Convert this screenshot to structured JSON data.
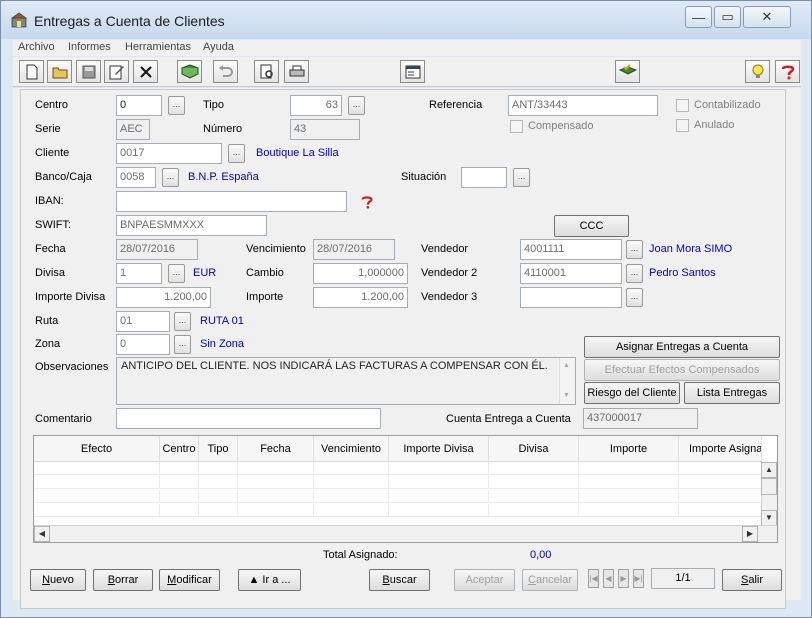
{
  "window": {
    "title": "Entregas a Cuenta de Clientes"
  },
  "menu": [
    "Archivo",
    "Informes",
    "Herramientas",
    "Ayuda"
  ],
  "labels": {
    "centro": "Centro",
    "tipo": "Tipo",
    "referencia": "Referencia",
    "contabilizado": "Contabilizado",
    "serie": "Serie",
    "numero": "Número",
    "compensado": "Compensado",
    "anulado": "Anulado",
    "cliente": "Cliente",
    "banco": "Banco/Caja",
    "situacion": "Situación",
    "iban": "IBAN:",
    "swift": "SWIFT:",
    "fecha": "Fecha",
    "vencimiento": "Vencimiento",
    "vendedor": "Vendedor",
    "divisa": "Divisa",
    "cambio": "Cambio",
    "vendedor2": "Vendedor 2",
    "importe_divisa": "Importe Divisa",
    "importe": "Importe",
    "vendedor3": "Vendedor 3",
    "ruta": "Ruta",
    "zona": "Zona",
    "observaciones": "Observaciones",
    "comentario": "Comentario",
    "cuenta_entrega": "Cuenta Entrega a Cuenta",
    "total_asignado": "Total Asignado:"
  },
  "values": {
    "centro": "0",
    "tipo": "63",
    "referencia": "ANT/33443",
    "serie": "AEC",
    "numero": "43",
    "cliente_code": "0017",
    "cliente_name": "Boutique La Silla",
    "banco_code": "0058",
    "banco_name": "B.N.P. España",
    "situacion": "",
    "iban": "",
    "swift": "BNPAESMMXXX",
    "fecha": "28/07/2016",
    "vencimiento": "28/07/2016",
    "vendedor_code": "4001111",
    "vendedor_name": "Joan Mora SIMO",
    "divisa_code": "1",
    "divisa_name": "EUR",
    "cambio": "1,000000",
    "vendedor2_code": "4110001",
    "vendedor2_name": "Pedro Santos",
    "importe_divisa": "1.200,00",
    "importe": "1.200,00",
    "vendedor3_code": "",
    "ruta_code": "01",
    "ruta_name": "RUTA 01",
    "zona_code": "0",
    "zona_name": "Sin Zona",
    "observaciones": "ANTICIPO DEL CLIENTE. NOS INDICARÁ LAS FACTURAS A COMPENSAR CON ÉL.",
    "comentario": "",
    "cuenta_entrega": "437000017",
    "total_asignado": "0,00",
    "page": "1/1"
  },
  "buttons": {
    "ccc": "CCC",
    "asignar": "Asignar Entregas a Cuenta",
    "efectuar": "Efectuar Efectos Compensados",
    "riesgo": "Riesgo del Cliente",
    "lista": "Lista Entregas",
    "nuevo": "Nuevo",
    "borrar": "Borrar",
    "modificar": "Modificar",
    "ira": "▲  Ir a ...",
    "buscar": "Buscar",
    "aceptar": "Aceptar",
    "cancelar": "Cancelar",
    "salir": "Salir",
    "dots": "..."
  },
  "grid": {
    "columns": [
      "Efecto",
      "Centro",
      "Tipo",
      "Fecha",
      "Vencimiento",
      "Importe Divisa",
      "Divisa",
      "Importe",
      "Importe Asigna"
    ],
    "rows": []
  },
  "colors": {
    "link": "#0000cc",
    "window_frame": "#dce9f5",
    "panel": "#f0f0f0"
  },
  "icons": [
    "new-icon",
    "open-icon",
    "save-icon",
    "edit-icon",
    "delete-icon",
    "book-icon",
    "undo-icon",
    "preview-icon",
    "print-icon",
    "form-icon",
    "book-check-icon",
    "lightbulb-icon",
    "help-icon"
  ]
}
